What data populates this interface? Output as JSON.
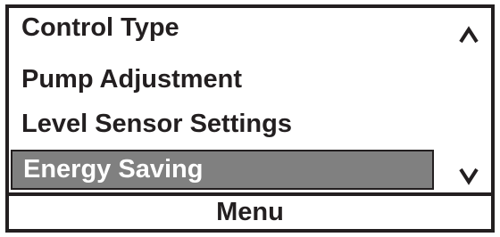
{
  "menu": {
    "items": [
      {
        "label": "Control Type",
        "selected": false
      },
      {
        "label": "Pump Adjustment",
        "selected": false
      },
      {
        "label": "Level Sensor Settings",
        "selected": false
      },
      {
        "label": "Energy Saving",
        "selected": true
      }
    ],
    "scroll_up_icon": "chevron-up-icon",
    "scroll_down_icon": "chevron-down-icon"
  },
  "footer": {
    "title": "Menu"
  },
  "colors": {
    "border": "#231f20",
    "selected_background": "#808080",
    "selected_text": "#ffffff",
    "text": "#231f20",
    "background": "#ffffff"
  }
}
